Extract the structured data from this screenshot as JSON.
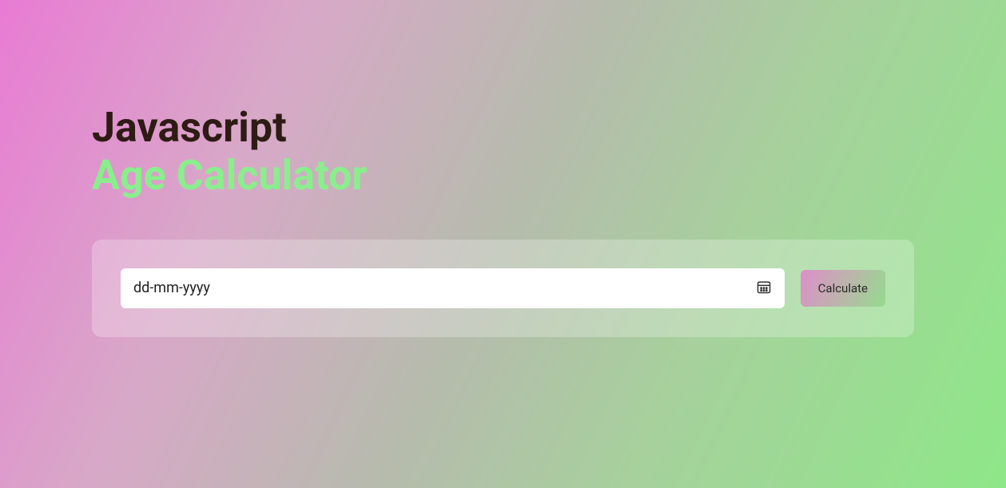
{
  "heading": {
    "line1": "Javascript",
    "line2": "Age Calculator"
  },
  "form": {
    "date_placeholder": "dd-mm-yyyy",
    "date_value": "",
    "calculate_label": "Calculate"
  }
}
